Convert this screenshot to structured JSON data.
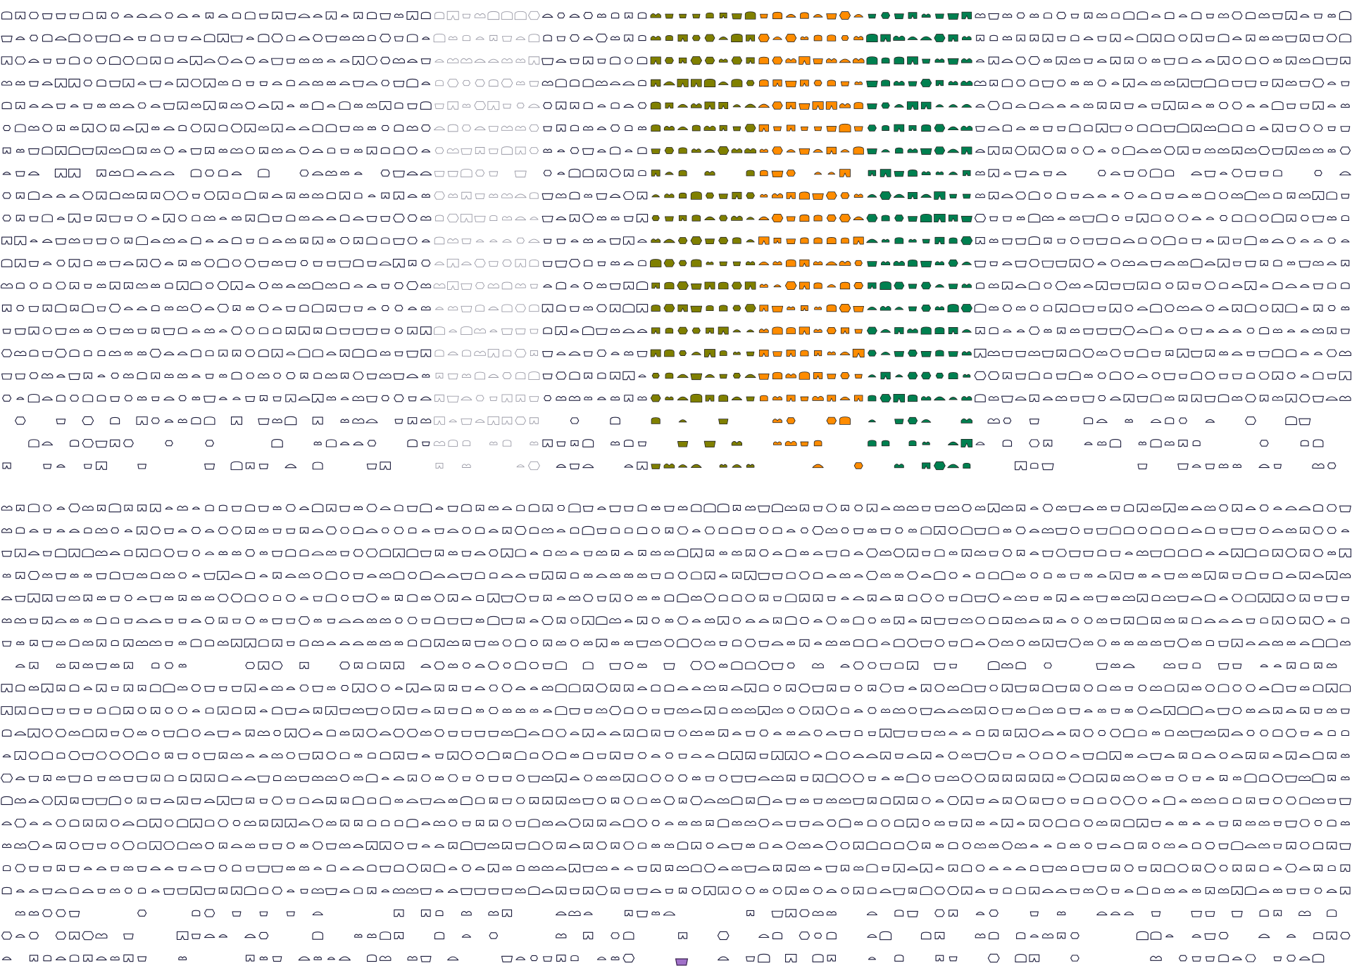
{
  "sheet": {
    "upper_block": {
      "rows": 21,
      "groups": [
        {
          "style": "outline-white",
          "columns": 8
        },
        {
          "style": "outline-white",
          "columns": 8
        },
        {
          "style": "outline-white",
          "columns": 8
        },
        {
          "style": "outline-white",
          "columns": 8
        },
        {
          "style": "outline-light-grey",
          "columns": 8
        },
        {
          "style": "outline-white",
          "columns": 8
        },
        {
          "style": "filled",
          "color": "#808000",
          "columns": 8
        },
        {
          "style": "filled",
          "color": "#ff8c00",
          "columns": 8
        },
        {
          "style": "filled",
          "color": "#008050",
          "columns": 8
        },
        {
          "style": "outline-white",
          "columns": 8
        },
        {
          "style": "outline-white",
          "columns": 8
        },
        {
          "style": "outline-white",
          "columns": 8
        },
        {
          "style": "outline-white",
          "columns": 8
        },
        {
          "style": "outline-white",
          "columns": 8
        },
        {
          "style": "outline-white",
          "columns": 8
        },
        {
          "style": "outline-white",
          "columns": 8
        },
        {
          "style": "outline-white",
          "columns": 8
        },
        {
          "style": "outline-white",
          "columns": 8
        },
        {
          "style": "outline-white",
          "columns": 8
        },
        {
          "style": "outline-white",
          "columns": 8
        }
      ]
    },
    "lower_block": {
      "rows": 21,
      "groups": [
        {
          "style": "outline-white",
          "columns": 8
        },
        {
          "style": "outline-white",
          "columns": 8
        },
        {
          "style": "outline-white",
          "columns": 8
        },
        {
          "style": "outline-white",
          "columns": 8
        },
        {
          "style": "outline-white",
          "columns": 8
        },
        {
          "style": "outline-white",
          "columns": 8
        },
        {
          "style": "outline-white",
          "columns": 8
        },
        {
          "style": "outline-white",
          "columns": 8
        },
        {
          "style": "outline-white",
          "columns": 8
        },
        {
          "style": "outline-white",
          "columns": 8
        },
        {
          "style": "outline-white",
          "columns": 8
        },
        {
          "style": "outline-white",
          "columns": 8
        },
        {
          "style": "outline-white",
          "columns": 8
        },
        {
          "style": "outline-white",
          "columns": 8
        },
        {
          "style": "outline-white",
          "columns": 8
        },
        {
          "style": "outline-white",
          "columns": 8
        },
        {
          "style": "filled",
          "color": "#8b1a2b",
          "columns": 8
        },
        {
          "style": "filled",
          "color": "#3a2a9a",
          "columns": 8
        }
      ]
    },
    "highlight_color": "#a070c8",
    "outline_color": "#1a1a3a"
  }
}
